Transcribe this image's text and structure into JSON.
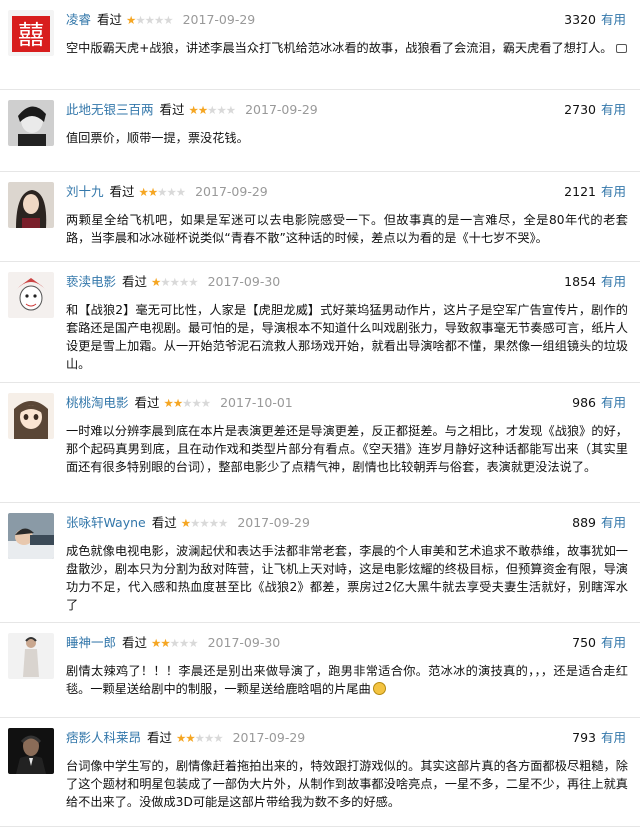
{
  "useful_label": "有用",
  "verb": "看过",
  "accent": "#3377aa",
  "star_color": "#f5a623",
  "reviews": [
    {
      "user": "凌睿",
      "rating": 1,
      "date": "2017-09-29",
      "votes": "3320",
      "avatar": "red-double-happiness",
      "text": "空中版霸天虎+战狼，讲述李晨当众打飞机给范冰冰看的故事，战狼看了会流泪，霸天虎看了想打人。",
      "trailing": "more-icon"
    },
    {
      "user": "此地无银三百两",
      "rating": 2,
      "date": "2017-09-29",
      "votes": "2730",
      "avatar": "bw-portrait",
      "text": "值回票价，顺带一提，票没花钱。"
    },
    {
      "user": "刘十九",
      "rating": 2,
      "date": "2017-09-29",
      "votes": "2121",
      "avatar": "woman-portrait",
      "text": "两颗星全给飞机吧，如果是军迷可以去电影院感受一下。但故事真的是一言难尽，全是80年代的老套路，当李晨和冰冰碰杯说类似“青春不散”这种话的时候，差点以为看的是《十七岁不哭》。"
    },
    {
      "user": "亵渎电影",
      "rating": 1,
      "date": "2017-09-30",
      "votes": "1854",
      "avatar": "drawn-character",
      "text": "和【战狼2】毫无可比性，人家是【虎胆龙威】式好莱坞猛男动作片，这片子是空军广告宣传片，剧作的套路还是国产电视剧。最可怕的是，导演根本不知道什么叫戏剧张力，导致叙事毫无节奏感可言，纸片人设更是雪上加霜。从一开始范爷泥石流救人那场戏开始，就看出导演啥都不懂，果然像一组组镜头的垃圾山。"
    },
    {
      "user": "桃桃淘电影",
      "rating": 2,
      "date": "2017-10-01",
      "votes": "986",
      "avatar": "anime-girl",
      "text": "一时难以分辨李晨到底在本片是表演更差还是导演更差，反正都挺差。与之相比，才发现《战狼》的好，那个起码真男到底，且在动作戏和类型片部分有看点。《空天猎》连岁月静好这种话都能写出来（其实里面还有很多特别眼的台词），整部电影少了点精气神，剧情也比较朝弄与俗套，表演就更没法说了。"
    },
    {
      "user": "张咏轩Wayne",
      "rating": 1,
      "date": "2017-09-29",
      "votes": "889",
      "avatar": "man-lying",
      "text": "成色就像电视电影，波澜起伏和表达手法都非常老套，李晨的个人审美和艺术追求不敢恭维，故事犹如一盘散沙，剧本只为分割为敌对阵营，让飞机上天对峙，这是电影炫耀的终极目标，但预算资金有限，导演功力不足，代入感和热血度甚至比《战狼2》都差，票房过2亿大黑牛就去享受夫妻生活就好，别瞎浑水了"
    },
    {
      "user": "睡神一郎",
      "rating": 2,
      "date": "2017-09-30",
      "votes": "750",
      "avatar": "standing-figure",
      "text": "剧情太辣鸡了！！！李晨还是别出来做导演了，跑男非常适合你。范冰冰的演技真的，，，还是适合走红毯。一颗星送给剧中的制服，一颗星送给鹿晗唱的片尾曲",
      "trailing": "emoji-icon"
    },
    {
      "user": "痞影人科莱昂",
      "rating": 2,
      "date": "2017-09-29",
      "votes": "793",
      "avatar": "godfather",
      "text": "台词像中学生写的，剧情像赶着拖拍出来的，特效跟打游戏似的。其实这部片真的各方面都极尽粗糙，除了这个题材和明星包装成了一部伪大片外，从制作到故事都没啥亮点，一星不多，二星不少，再往上就真给不出来了。没做成3D可能是这部片带给我为数不多的好感。"
    }
  ]
}
